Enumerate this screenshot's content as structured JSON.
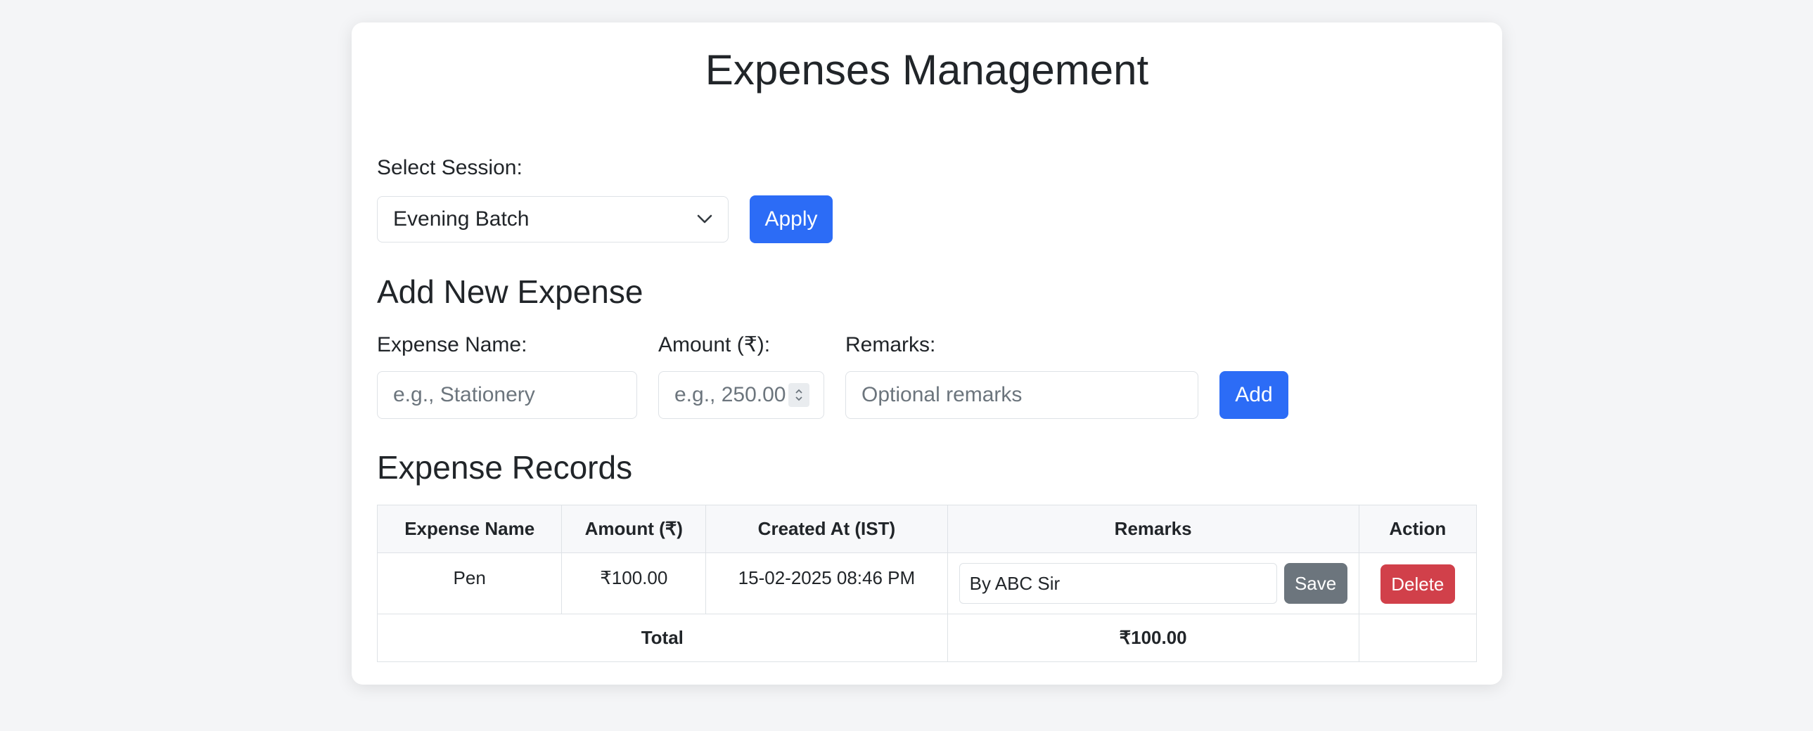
{
  "page": {
    "title": "Expenses Management"
  },
  "session": {
    "label": "Select Session:",
    "selected": "Evening Batch",
    "apply_label": "Apply"
  },
  "add_expense": {
    "title": "Add New Expense",
    "name_label": "Expense Name:",
    "name_placeholder": "e.g., Stationery",
    "amount_label": "Amount (₹):",
    "amount_placeholder": "e.g., 250.00",
    "remarks_label": "Remarks:",
    "remarks_placeholder": "Optional remarks",
    "add_label": "Add"
  },
  "records": {
    "title": "Expense Records",
    "headers": [
      "Expense Name",
      "Amount (₹)",
      "Created At (IST)",
      "Remarks",
      "Action"
    ],
    "rows": [
      {
        "name": "Pen",
        "amount": "₹100.00",
        "created_at": "15-02-2025 08:46 PM",
        "remarks": "By ABC Sir",
        "save_label": "Save",
        "delete_label": "Delete"
      }
    ],
    "total_label": "Total",
    "total_value": "₹100.00"
  },
  "colors": {
    "primary": "#2c6cf6",
    "secondary": "#6c757d",
    "danger": "#d1404a"
  }
}
